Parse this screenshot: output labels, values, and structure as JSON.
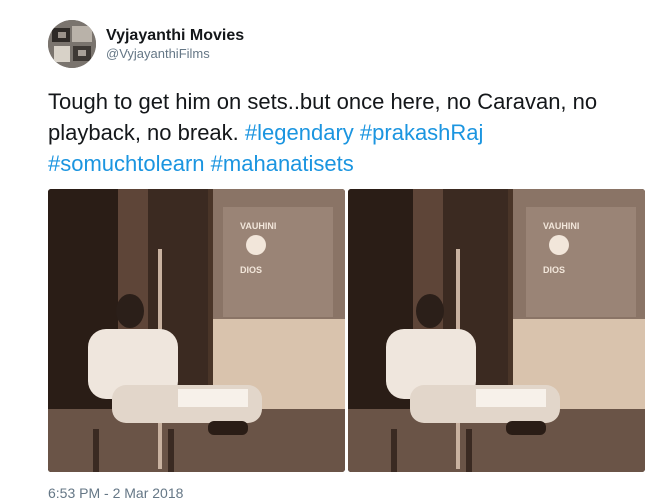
{
  "user": {
    "display_name": "Vyjayanthi Movies",
    "handle": "@VyjayanthiFilms"
  },
  "tweet": {
    "text_plain": "Tough to get him on sets..but once here, no Caravan, no playback, no break. ",
    "hashtags": [
      "#legendary",
      "#prakashRaj",
      "#somuchtolearn",
      "#mahanatisets"
    ],
    "timestamp": "6:53 PM - 2 Mar 2018"
  },
  "media": {
    "photos": [
      {
        "sign_text_1": "VAUHINI",
        "sign_text_2": "DIOS"
      },
      {
        "sign_text_1": "VAUHINI",
        "sign_text_2": "DIOS"
      }
    ]
  },
  "colors": {
    "hashtag": "#1b95e0",
    "secondary_text": "#657786",
    "primary_text": "#14171a"
  }
}
